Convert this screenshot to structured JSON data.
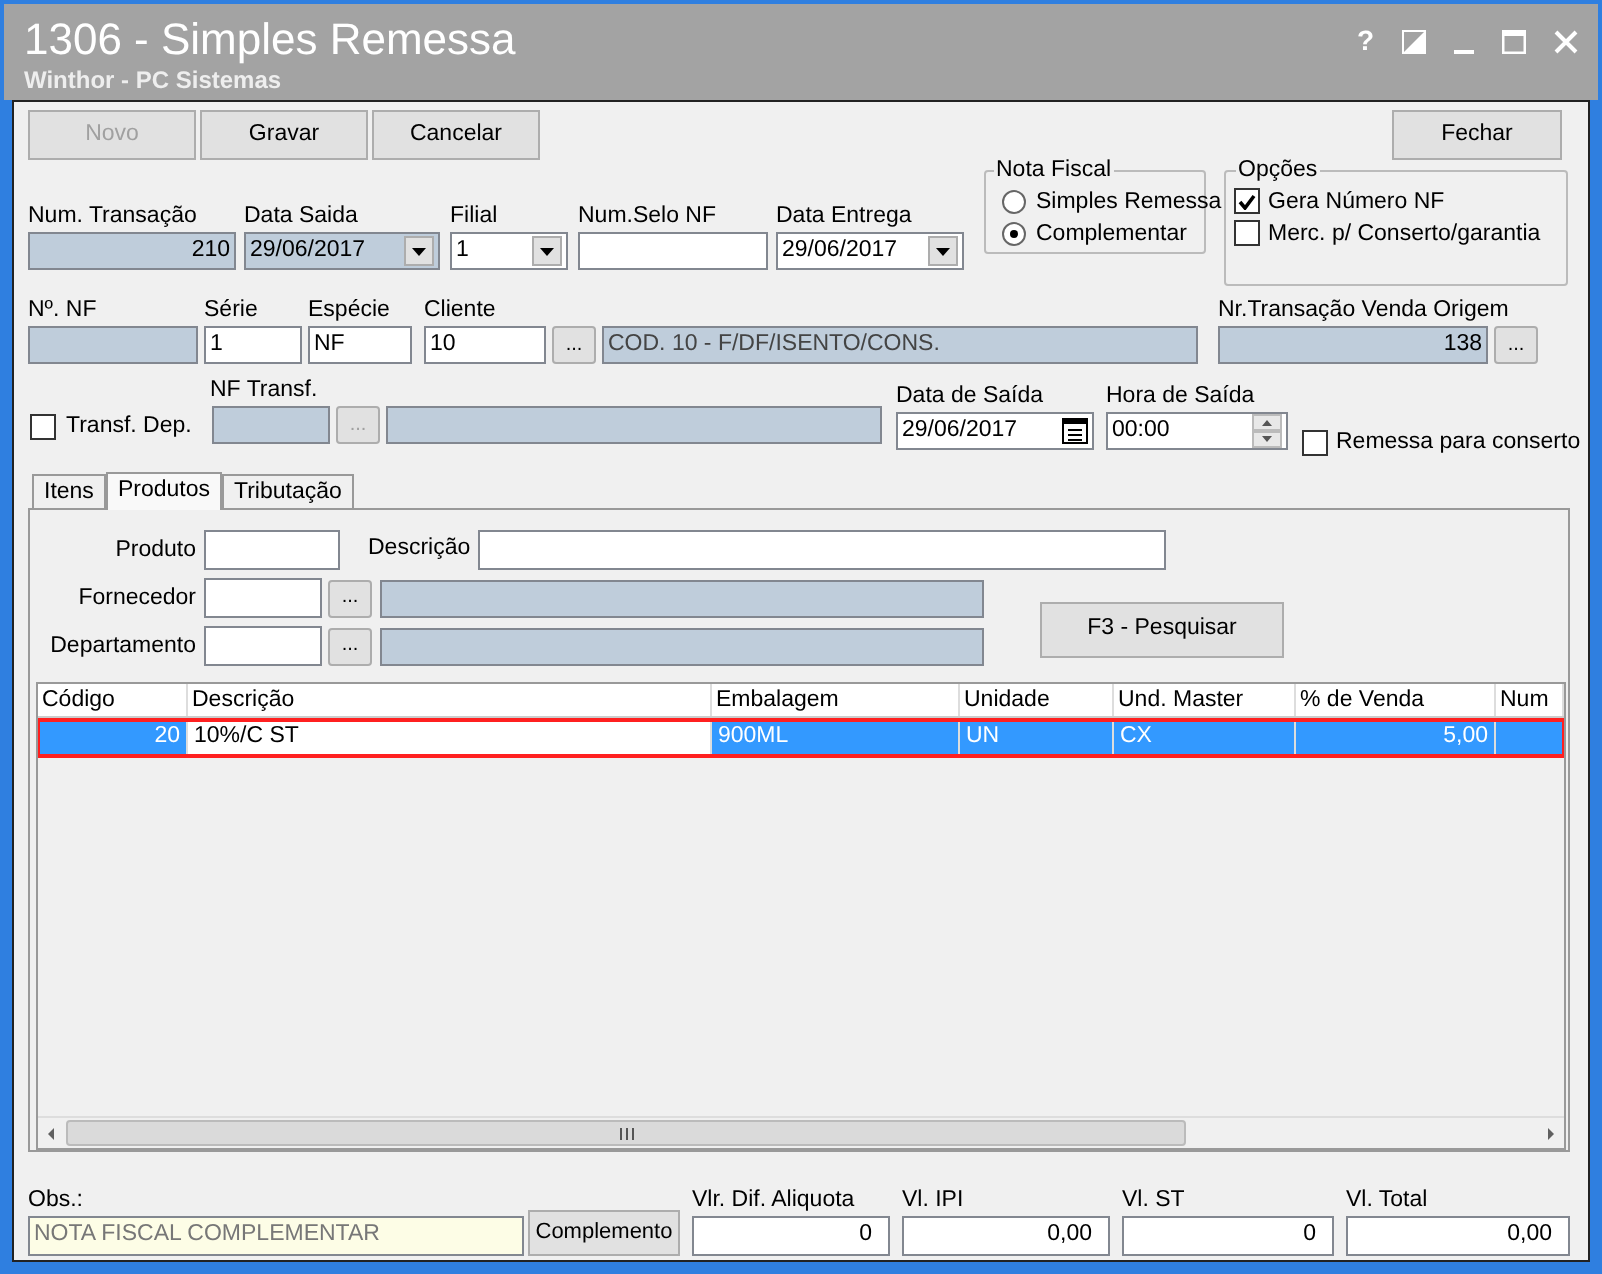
{
  "window": {
    "title": "1306 - Simples Remessa",
    "subtitle": "Winthor - PC Sistemas",
    "help": "?"
  },
  "toolbar": [
    {
      "label": "Novo",
      "disabled": true
    },
    {
      "label": "Gravar",
      "disabled": false
    },
    {
      "label": "Cancelar",
      "disabled": false
    },
    {
      "label": "Fechar",
      "disabled": false
    }
  ],
  "header_fields": [
    {
      "label": "Num. Transação",
      "value": "210",
      "kind": "number",
      "readonly": true
    },
    {
      "label": "Data Saida",
      "value": "29/06/2017",
      "kind": "dropdown",
      "readonly": true
    },
    {
      "label": "Filial",
      "value": "1",
      "kind": "dropdown",
      "readonly": false
    },
    {
      "label": "Num.Selo NF",
      "kind": "text",
      "readonly": false
    },
    {
      "label": "Data Entrega",
      "value": "29/06/2017",
      "kind": "dropdown",
      "readonly": false
    }
  ],
  "nota_fiscal": {
    "title": "Nota Fiscal",
    "options": [
      {
        "label": "Simples Remessa",
        "selected": false
      },
      {
        "label": "Complementar",
        "selected": true
      }
    ]
  },
  "opcoes": {
    "title": "Opções",
    "options": [
      {
        "label": "Gera Número NF",
        "checked": true
      },
      {
        "label": "Merc. p/ Conserto/garantia",
        "checked": false
      }
    ]
  },
  "row2": {
    "nf": {
      "label": "Nº. NF",
      "readonly": true
    },
    "serie": {
      "label": "Série",
      "value": "1"
    },
    "especie": {
      "label": "Espécie",
      "value": "NF"
    },
    "cliente": {
      "label": "Cliente",
      "value": "10",
      "browse": "...",
      "name": "COD. 10 - F/DF/ISENTO/CONS."
    },
    "origem": {
      "label": "Nr.Transação Venda Origem",
      "value": "138",
      "browse": "..."
    }
  },
  "row3": {
    "transf_dep": {
      "label": "Transf. Dep.",
      "checked": false
    },
    "nf_transf": {
      "label": "NF Transf.",
      "browse": "...",
      "disabled": true
    },
    "data_saida": {
      "label": "Data de Saída",
      "value": "29/06/2017"
    },
    "hora_saida": {
      "label": "Hora de Saída",
      "value": "00:00"
    },
    "remessa": {
      "label": "Remessa para conserto",
      "checked": false
    }
  },
  "tabs": [
    {
      "label": "Itens",
      "selected": false
    },
    {
      "label": "Produtos",
      "selected": true
    },
    {
      "label": "Tributação",
      "selected": false
    }
  ],
  "filters": {
    "produto": "Produto",
    "descricao": "Descrição",
    "fornecedor": {
      "label": "Fornecedor",
      "browse": "..."
    },
    "departamento": {
      "label": "Departamento",
      "browse": "..."
    },
    "search_button": "F3 - Pesquisar"
  },
  "table": {
    "columns": [
      "Código",
      "Descrição",
      "Embalagem",
      "Unidade",
      "Und. Master",
      "% de Venda",
      "Num"
    ],
    "rows": [
      {
        "cells": [
          "20",
          "10%/C ST",
          "900ML",
          "UN",
          "CX",
          "5,00"
        ],
        "selected": true,
        "highlighted": true
      }
    ]
  },
  "footer": {
    "obs_label": "Obs.:",
    "obs_value": "NOTA FISCAL COMPLEMENTAR",
    "complemento": "Complemento",
    "totals": [
      {
        "label": "Vlr. Dif. Aliquota",
        "value": "0"
      },
      {
        "label": "Vl. IPI",
        "value": "0,00"
      },
      {
        "label": "Vl. ST",
        "value": "0"
      },
      {
        "label": "Vl. Total",
        "value": "0,00"
      }
    ]
  }
}
